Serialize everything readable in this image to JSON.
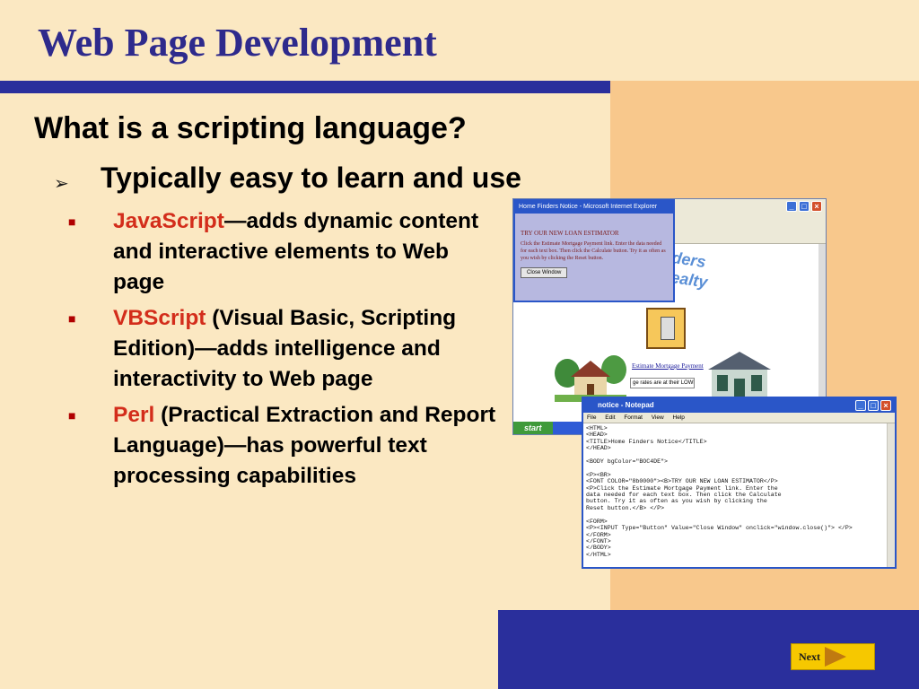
{
  "slide": {
    "title": "Web Page Development",
    "heading": "What is a scripting language?",
    "sub_point": "Typically easy to learn and use",
    "bullets": [
      {
        "term": "JavaScript",
        "rest": "—adds dynamic content and interactive elements to Web page"
      },
      {
        "term": "VBScript",
        "rest": " (Visual Basic, Scripting Edition)—adds intelligence and interactivity to Web page"
      },
      {
        "term": "Perl",
        "rest": " (Practical Extraction and Report Language)—has powerful text processing capabilities"
      }
    ],
    "next_label": "Next"
  },
  "ie_screenshot": {
    "dialog_title": "Home Finders Notice - Microsoft Internet Explorer",
    "dialog_heading": "TRY OUR NEW LOAN ESTIMATOR",
    "dialog_text": "Click the Estimate Mortgage Payment link. Enter the data needed for each text box. Then click the Calculate button. Try it as often as you wish by clicking the Reset button.",
    "dialog_button": "Close Window",
    "logo_text": "nders\nRealty",
    "estimate_link": "Estimate Mortgage Payment",
    "rates_field": "ge rates are at their LOWE",
    "start_label": "start"
  },
  "notepad": {
    "title": "notice - Notepad",
    "menu": [
      "File",
      "Edit",
      "Format",
      "View",
      "Help"
    ],
    "code": "<HTML>\n<HEAD>\n<TITLE>Home Finders Notice</TITLE>\n</HEAD>\n\n<BODY bgColor=\"BOC4DE\">\n\n<P><BR>\n<FONT COLOR=\"8b0000\"><B>TRY OUR NEW LOAN ESTIMATOR</P>\n<P>Click the Estimate Mortgage Payment link. Enter the\ndata needed for each text box. Then click the Calculate\nbutton. Try it as often as you wish by clicking the\nReset button.</B> </P>\n\n<FORM>\n<P><INPUT Type=\"Button\" Value=\"Close Window\" onclick=\"window.close()\"> </P>\n</FORM>\n</FONT>\n</BODY>\n</HTML>"
  },
  "colors": {
    "title": "#2e2a8c",
    "accent_blue": "#2a2f9c",
    "term_red": "#d32d1b",
    "background": "#fbe8c2",
    "right_panel": "#f8c88c",
    "next_button": "#f6c800"
  }
}
